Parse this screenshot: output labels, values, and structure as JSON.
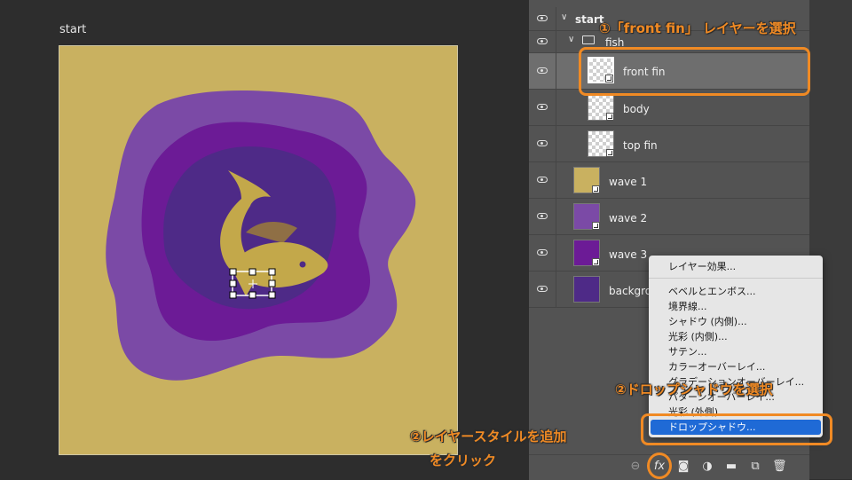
{
  "document": {
    "title": "start"
  },
  "layers": {
    "group_start": "start",
    "group_fish": "fish",
    "front_fin": "front fin",
    "body": "body",
    "top_fin": "top fin",
    "wave1": "wave 1",
    "wave2": "wave 2",
    "wave3": "wave 3",
    "background": "background"
  },
  "menu": {
    "items": [
      "レイヤー効果...",
      "ベベルとエンボス...",
      "境界線...",
      "シャドウ (内側)...",
      "光彩 (内側)...",
      "サテン...",
      "カラーオーバーレイ...",
      "グラデーションオーバーレイ...",
      "パターンオーバーレイ...",
      "光彩 (外側)..."
    ],
    "selected": "ドロップシャドウ..."
  },
  "annotations": {
    "step1": "①「front fin」 レイヤーを選択",
    "step2a": "②レイヤースタイルを追加",
    "step2b": "をクリック",
    "step3": "②ドロップシャドウを選択"
  },
  "colors": {
    "accent": "#f08a24",
    "background_fill": "#c9b160",
    "purple_light": "#7b4aa6",
    "purple_mid": "#6c1b96",
    "purple_dark": "#4e2a87",
    "fish": "#c3a84a",
    "menu_highlight": "#1f6ad6"
  },
  "icons": [
    "eye-icon",
    "folder-icon",
    "chevron-down-icon",
    "link-icon",
    "fx-icon",
    "mask-icon",
    "adjustment-icon",
    "new-group-icon",
    "new-layer-icon",
    "trash-icon"
  ]
}
